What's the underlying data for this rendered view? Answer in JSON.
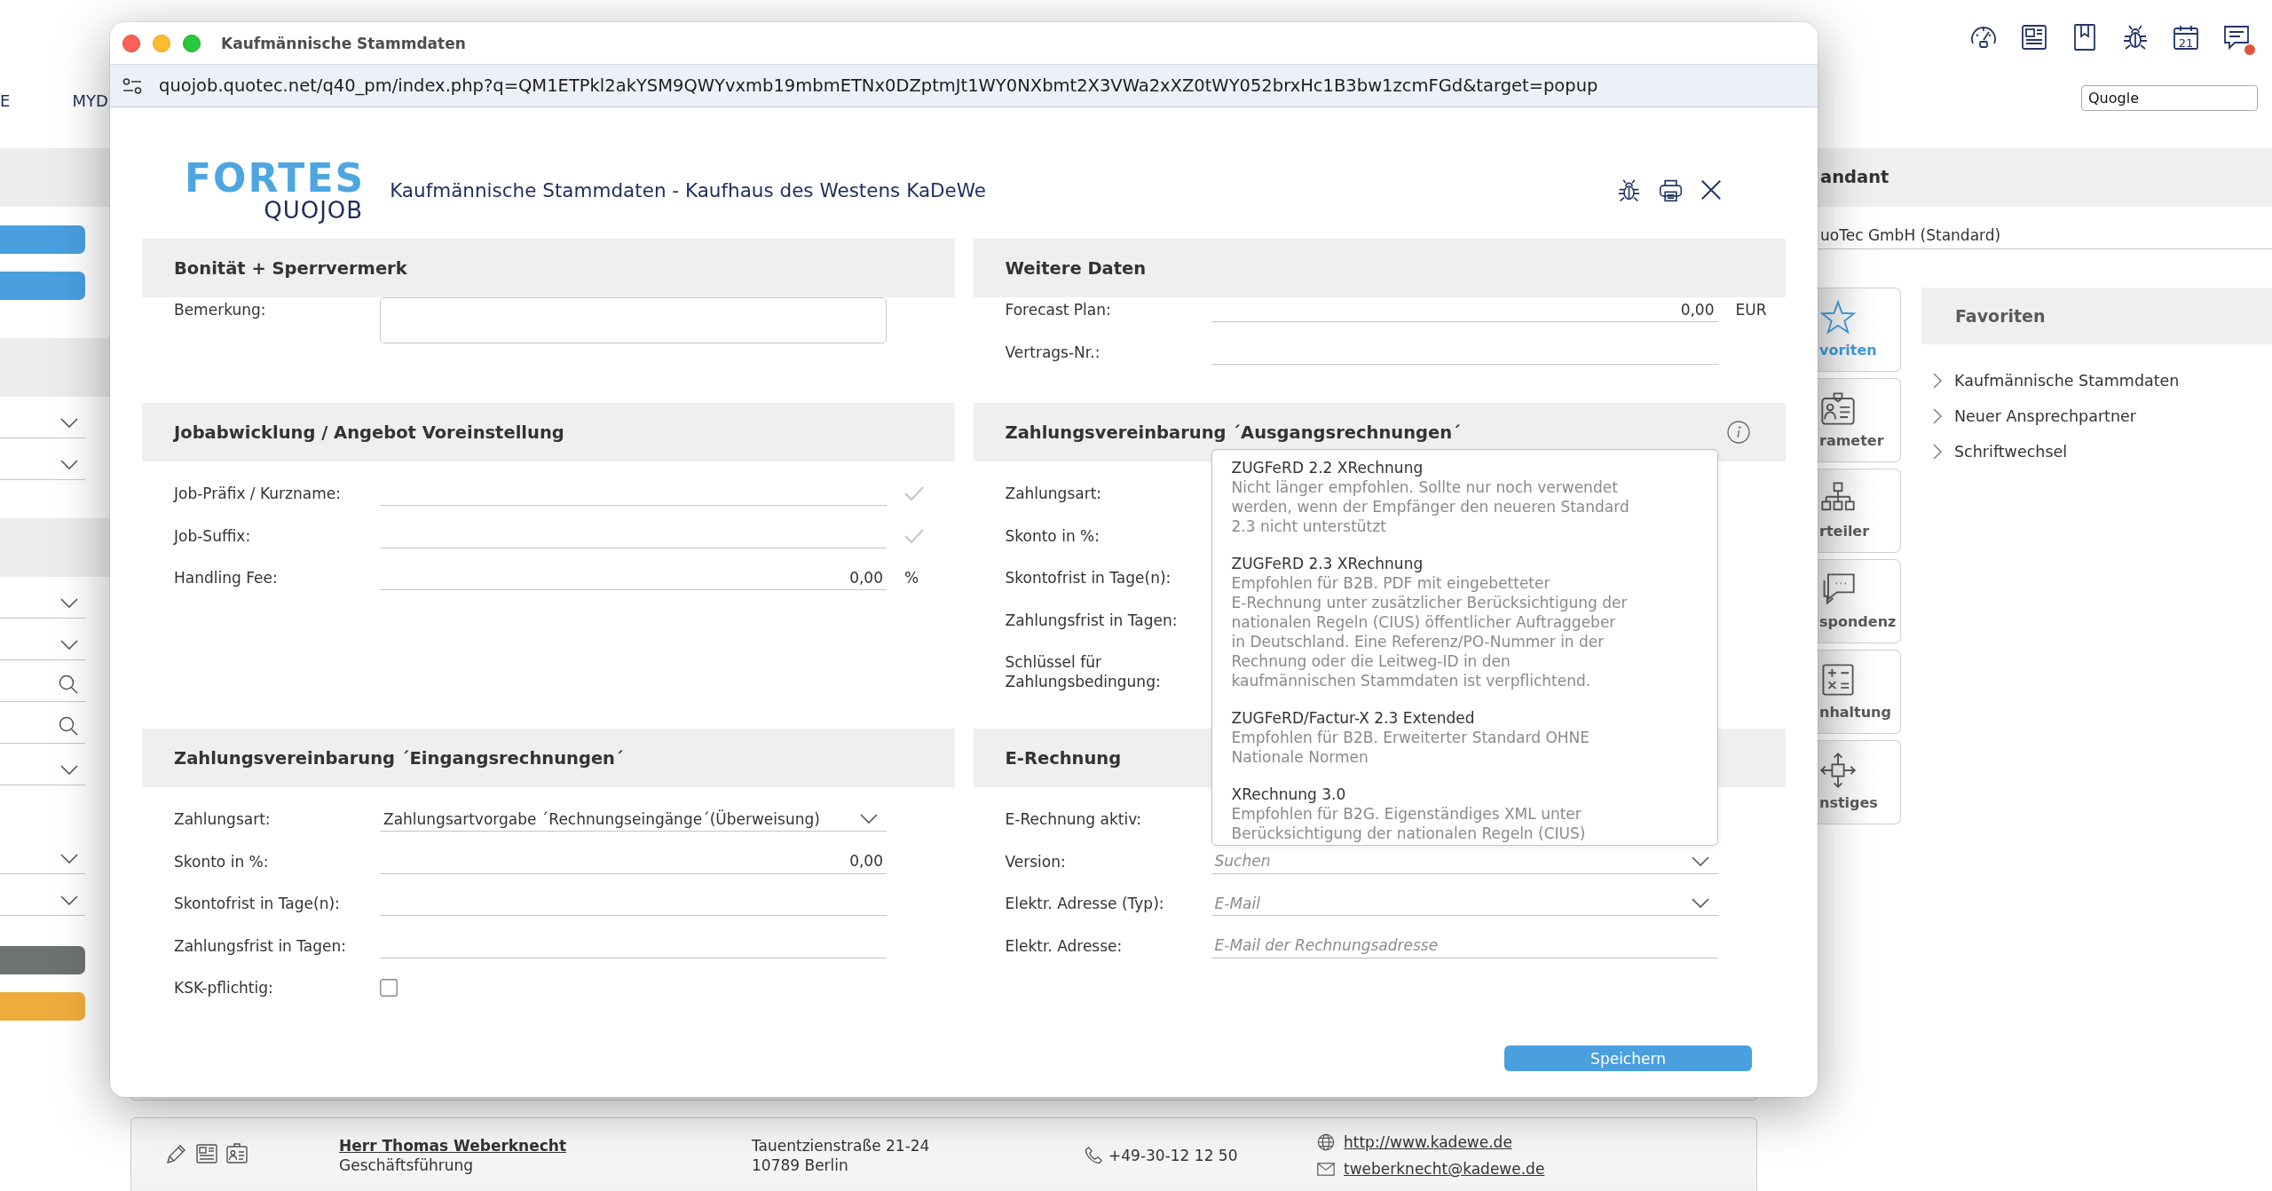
{
  "background": {
    "nav": [
      "E",
      "MYD"
    ],
    "toolbar": {
      "calendar_day": "21",
      "unread": true
    },
    "search": {
      "value": "Quogle"
    },
    "sidebar": {
      "groups": [
        {
          "header": true,
          "items": [
            {
              "kind": "button",
              "color": "#4a9fdf"
            },
            {
              "kind": "button",
              "color": "#4a9fdf"
            }
          ]
        },
        {
          "header": true,
          "items": [
            {
              "kind": "select"
            },
            {
              "kind": "select"
            }
          ]
        },
        {
          "header": true,
          "items": [
            {
              "kind": "select"
            },
            {
              "kind": "select"
            },
            {
              "kind": "search"
            },
            {
              "kind": "search"
            },
            {
              "kind": "select"
            }
          ]
        },
        {
          "header": false,
          "items": [
            {
              "kind": "select"
            },
            {
              "kind": "select"
            },
            {
              "kind": "button",
              "color": "#6e7371"
            },
            {
              "kind": "button",
              "color": "#efac3d"
            }
          ]
        }
      ]
    },
    "mandant": {
      "title": "andant",
      "value": "uoTec GmbH (Standard)"
    },
    "tabs": [
      {
        "label": "voriten",
        "selected": true
      },
      {
        "label": "rameter",
        "selected": false
      },
      {
        "label": "rteiler",
        "selected": false
      },
      {
        "label": "spondenz",
        "selected": false
      },
      {
        "label": "nhaltung",
        "selected": false
      },
      {
        "label": "nstiges",
        "selected": false
      }
    ],
    "favorites": {
      "title": "Favoriten",
      "items": [
        "Kaufmännische Stammdaten",
        "Neuer Ansprechpartner",
        "Schriftwechsel"
      ]
    },
    "contact": {
      "name": "Herr Thomas Weberknecht",
      "role": "Geschäftsführung",
      "street": "Tauentzienstraße 21-24",
      "city": "10789 Berlin",
      "phone": "+49-30-12 12 50",
      "website": "http://www.kadewe.de",
      "email": "tweberknecht@kadewe.de"
    }
  },
  "window": {
    "title": "Kaufmännische Stammdaten",
    "url": "quojob.quotec.net/q40_pm/index.php?q=QM1ETPkl2akYSM9QWYvxmb19mbmETNx0DZptmJt1WY0NXbmt2X3VWa2xXZ0tWY052brxHc1B3bw1zcmFGd&target=popup",
    "logo": {
      "name": "FORTES",
      "subtitle": "QUOJOB"
    },
    "heading": "Kaufmännische Stammdaten - Kaufhaus des Westens KaDeWe",
    "sections": [
      {
        "title": "Bonität + Sperrvermerk",
        "rows": [
          {
            "label": "Bemerkung:",
            "kind": "textarea"
          }
        ]
      },
      {
        "title": "Weitere Daten",
        "rows": [
          {
            "label": "Forecast Plan:",
            "kind": "number",
            "value": "0,00",
            "unit": "EUR"
          },
          {
            "label": "Vertrags-Nr.:",
            "kind": "text"
          }
        ]
      },
      {
        "title": "Jobabwicklung / Angebot Voreinstellung",
        "rows": [
          {
            "label": "Job-Präfix / Kurzname:",
            "kind": "text",
            "valid": true
          },
          {
            "label": "Job-Suffix:",
            "kind": "text",
            "valid": true
          },
          {
            "label": "Handling Fee:",
            "kind": "number",
            "value": "0,00",
            "unit": "%"
          }
        ]
      },
      {
        "title": "Zahlungsvereinbarung ´Ausgangsrechnungen´",
        "info": true,
        "rows": [
          {
            "label": "Zahlungsart:",
            "kind": "label"
          },
          {
            "label": "Skonto in %:",
            "kind": "label"
          },
          {
            "label": "Skontofrist in Tage(n):",
            "kind": "label"
          },
          {
            "label": "Zahlungsfrist in Tagen:",
            "kind": "label"
          },
          {
            "label": "Schlüssel für Zahlungsbedingung:",
            "kind": "label"
          }
        ]
      },
      {
        "title": "Zahlungsvereinbarung ´Eingangsrechnungen´",
        "rows": [
          {
            "label": "Zahlungsart:",
            "kind": "select",
            "value": "Zahlungsartvorgabe ´Rechnungseingänge´(Überweisung)"
          },
          {
            "label": "Skonto in %:",
            "kind": "number",
            "value": "0,00"
          },
          {
            "label": "Skontofrist in Tage(n):",
            "kind": "text"
          },
          {
            "label": "Zahlungsfrist in Tagen:",
            "kind": "text"
          },
          {
            "label": "KSK-pflichtig:",
            "kind": "checkbox",
            "checked": false
          }
        ]
      },
      {
        "title": "E-Rechnung",
        "rows": [
          {
            "label": "E-Rechnung aktiv:",
            "kind": "label"
          },
          {
            "label": "Version:",
            "kind": "select",
            "placeholder": "Suchen",
            "expanded": true,
            "options": [
              {
                "title": "ZUGFeRD 2.2 XRechnung",
                "description": "Nicht länger empfohlen. Sollte nur noch verwendet\nwerden, wenn der Empfänger den neueren Standard\n2.3 nicht unterstützt",
                "selected": false
              },
              {
                "title": "ZUGFeRD 2.3 XRechnung",
                "description": "Empfohlen für B2B. PDF mit eingebetteter\nE-Rechnung unter zusätzlicher Berücksichtigung der\nnationalen Regeln (CIUS) öffentlicher Auftraggeber\nin Deutschland. Eine Referenz/PO-Nummer in der\nRechnung oder die Leitweg-ID in den\nkaufmännischen Stammdaten ist verpflichtend.",
                "selected": false
              },
              {
                "title": "ZUGFeRD/Factur-X 2.3 Extended",
                "description": "Empfohlen für B2B. Erweiterter Standard OHNE\nNationale Normen",
                "selected": false
              },
              {
                "title": "XRechnung 3.0",
                "description": "Empfohlen für B2G. Eigenständiges XML unter\nBerücksichtigung der nationalen Regeln (CIUS)",
                "selected": false
              }
            ]
          },
          {
            "label": "Elektr. Adresse (Typ):",
            "kind": "select",
            "placeholder": "E-Mail"
          },
          {
            "label": "Elektr. Adresse:",
            "kind": "text",
            "placeholder": "E-Mail der Rechnungsadresse"
          }
        ]
      }
    ],
    "save_button": "Speichern"
  }
}
